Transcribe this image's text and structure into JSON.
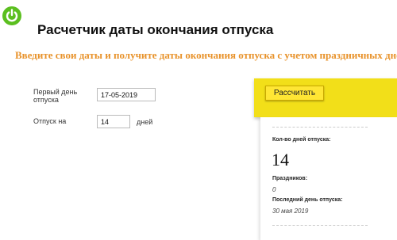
{
  "header": {
    "title": "Расчетчик даты окончания отпуска",
    "subtitle": "Введите свои даты и получите даты окончания отпуска с учетом праздничных дней",
    "logo_icon": "power-icon",
    "brand_color": "#5bbf1f",
    "subtitle_color": "#e8922a"
  },
  "form": {
    "first_day_label": "Первый день отпуска",
    "first_day_value": "17-05-2019",
    "vacation_label": "Отпуск на",
    "vacation_value": "14",
    "vacation_unit": "дней"
  },
  "action": {
    "calculate_label": "Рассчитать",
    "accent_color": "#f2df19"
  },
  "results": {
    "days_label": "Кол-во дней отпуска:",
    "days_value": "14",
    "holidays_label": "Праздников:",
    "holidays_value": "0",
    "last_day_label": "Последний день отпуска:",
    "last_day_value": "30 мая 2019"
  }
}
